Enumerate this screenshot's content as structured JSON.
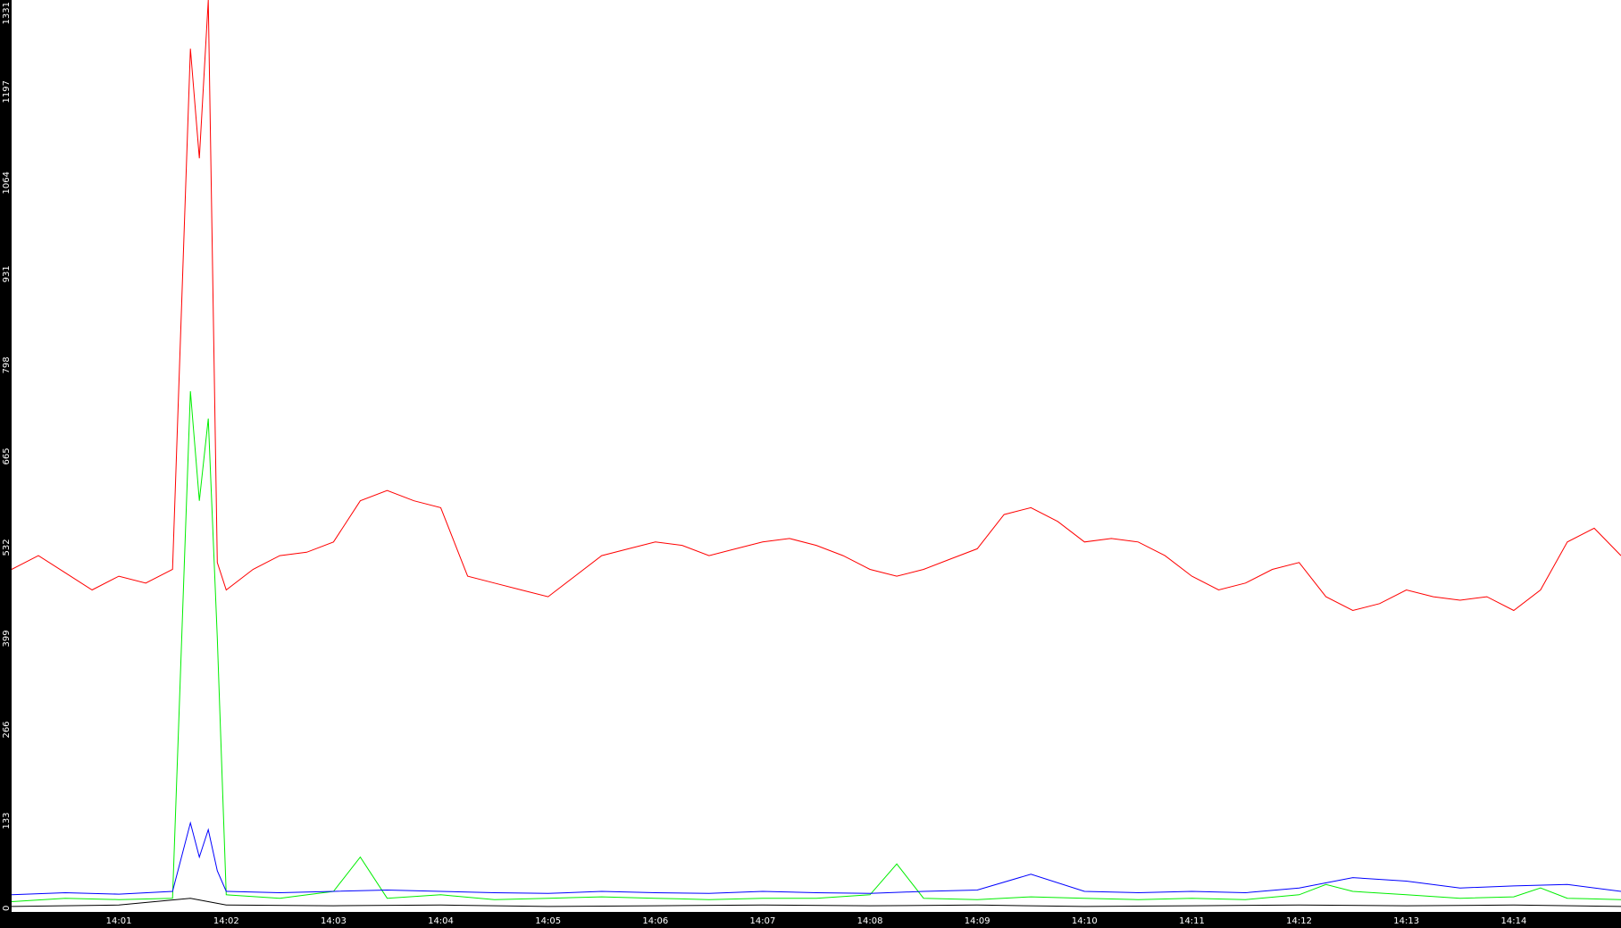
{
  "colors": {
    "background": "#ffffff",
    "axis_band": "#000000",
    "tick_text": "#ffffff",
    "series_red": "#ff0000",
    "series_green": "#00ee00",
    "series_blue": "#0000ff",
    "series_black": "#000000"
  },
  "chart_data": {
    "type": "line",
    "title": "",
    "xlabel": "",
    "ylabel": "",
    "grid": false,
    "legend": "none",
    "ylim": [
      0,
      1331
    ],
    "xlim": [
      "14:00",
      "14:15"
    ],
    "y_ticks": [
      "0",
      "133",
      "266",
      "399",
      "532",
      "665",
      "798",
      "931",
      "1064",
      "1197",
      "1331"
    ],
    "x_ticks": [
      "14:01",
      "14:02",
      "14:03",
      "14:04",
      "14:05",
      "14:06",
      "14:07",
      "14:08",
      "14:09",
      "14:10",
      "14:11",
      "14:12",
      "14:13",
      "14:14"
    ],
    "series": [
      {
        "color": "#ff0000",
        "x": [
          "14:00:00",
          "14:00:15",
          "14:00:30",
          "14:00:45",
          "14:01:00",
          "14:01:15",
          "14:01:30",
          "14:01:40",
          "14:01:45",
          "14:01:50",
          "14:01:55",
          "14:02:00",
          "14:02:15",
          "14:02:30",
          "14:02:45",
          "14:03:00",
          "14:03:15",
          "14:03:30",
          "14:03:45",
          "14:04:00",
          "14:04:15",
          "14:04:30",
          "14:04:45",
          "14:05:00",
          "14:05:15",
          "14:05:30",
          "14:05:45",
          "14:06:00",
          "14:06:15",
          "14:06:30",
          "14:06:45",
          "14:07:00",
          "14:07:15",
          "14:07:30",
          "14:07:45",
          "14:08:00",
          "14:08:15",
          "14:08:30",
          "14:08:45",
          "14:09:00",
          "14:09:15",
          "14:09:30",
          "14:09:45",
          "14:10:00",
          "14:10:15",
          "14:10:30",
          "14:10:45",
          "14:11:00",
          "14:11:15",
          "14:11:30",
          "14:11:45",
          "14:12:00",
          "14:12:15",
          "14:12:30",
          "14:12:45",
          "14:13:00",
          "14:13:15",
          "14:13:30",
          "14:13:45",
          "14:14:00",
          "14:14:15",
          "14:14:30",
          "14:14:45",
          "14:15:00"
        ],
        "values": [
          500,
          520,
          495,
          470,
          490,
          480,
          500,
          1260,
          1100,
          1331,
          510,
          470,
          500,
          520,
          525,
          540,
          600,
          615,
          600,
          590,
          490,
          480,
          470,
          460,
          490,
          520,
          530,
          540,
          535,
          520,
          530,
          540,
          545,
          535,
          520,
          500,
          490,
          500,
          515,
          530,
          580,
          590,
          570,
          540,
          545,
          540,
          520,
          490,
          470,
          480,
          500,
          510,
          460,
          440,
          450,
          470,
          460,
          455,
          460,
          440,
          470,
          540,
          560,
          520
        ]
      },
      {
        "color": "#00ee00",
        "x": [
          "14:00:00",
          "14:00:30",
          "14:01:00",
          "14:01:30",
          "14:01:40",
          "14:01:45",
          "14:01:50",
          "14:01:55",
          "14:02:00",
          "14:02:30",
          "14:03:00",
          "14:03:15",
          "14:03:30",
          "14:04:00",
          "14:04:30",
          "14:05:00",
          "14:05:30",
          "14:06:00",
          "14:06:30",
          "14:07:00",
          "14:07:30",
          "14:08:00",
          "14:08:15",
          "14:08:30",
          "14:09:00",
          "14:09:30",
          "14:10:00",
          "14:10:30",
          "14:11:00",
          "14:11:30",
          "14:12:00",
          "14:12:15",
          "14:12:30",
          "14:13:00",
          "14:13:30",
          "14:14:00",
          "14:14:15",
          "14:14:30",
          "14:15:00"
        ],
        "values": [
          15,
          20,
          18,
          20,
          760,
          600,
          720,
          400,
          25,
          20,
          30,
          80,
          20,
          25,
          18,
          20,
          22,
          20,
          18,
          20,
          20,
          25,
          70,
          20,
          18,
          22,
          20,
          18,
          20,
          18,
          25,
          40,
          30,
          25,
          20,
          22,
          35,
          20,
          18
        ]
      },
      {
        "color": "#0000ff",
        "x": [
          "14:00:00",
          "14:00:30",
          "14:01:00",
          "14:01:30",
          "14:01:40",
          "14:01:45",
          "14:01:50",
          "14:01:55",
          "14:02:00",
          "14:02:30",
          "14:03:00",
          "14:03:30",
          "14:04:00",
          "14:04:30",
          "14:05:00",
          "14:05:30",
          "14:06:00",
          "14:06:30",
          "14:07:00",
          "14:07:30",
          "14:08:00",
          "14:08:30",
          "14:09:00",
          "14:09:30",
          "14:10:00",
          "14:10:30",
          "14:11:00",
          "14:11:30",
          "14:12:00",
          "14:12:30",
          "14:13:00",
          "14:13:30",
          "14:14:00",
          "14:14:30",
          "14:15:00"
        ],
        "values": [
          25,
          28,
          26,
          30,
          130,
          80,
          120,
          60,
          30,
          28,
          30,
          32,
          30,
          28,
          27,
          30,
          28,
          27,
          30,
          28,
          27,
          30,
          32,
          55,
          30,
          28,
          30,
          28,
          35,
          50,
          45,
          35,
          38,
          40,
          30
        ]
      },
      {
        "color": "#000000",
        "x": [
          "14:00:00",
          "14:01:00",
          "14:01:40",
          "14:01:50",
          "14:02:00",
          "14:03:00",
          "14:04:00",
          "14:05:00",
          "14:06:00",
          "14:07:00",
          "14:08:00",
          "14:09:00",
          "14:10:00",
          "14:11:00",
          "14:12:00",
          "14:13:00",
          "14:14:00",
          "14:15:00"
        ],
        "values": [
          8,
          10,
          20,
          15,
          10,
          9,
          10,
          8,
          9,
          10,
          9,
          10,
          8,
          9,
          10,
          9,
          10,
          8
        ]
      }
    ]
  }
}
